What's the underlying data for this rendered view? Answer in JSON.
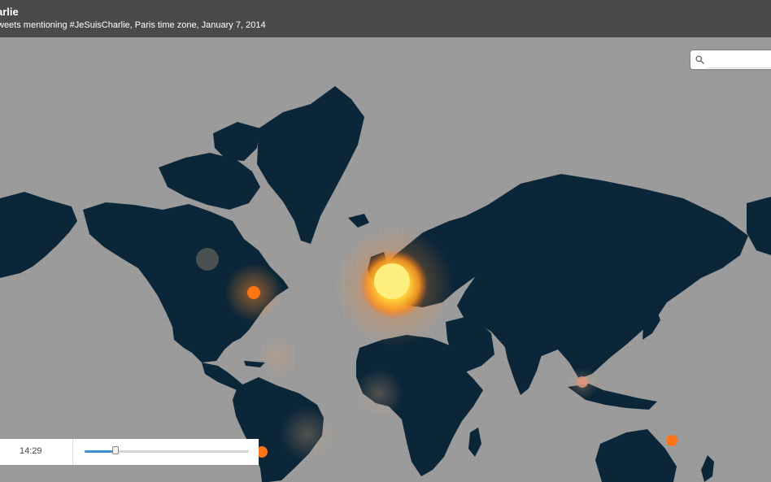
{
  "header": {
    "title": "arlie",
    "subtitle": "weets mentioning #JeSuisCharlie, Paris time zone, January 7, 2014"
  },
  "search": {
    "placeholder": ""
  },
  "timeline": {
    "time": "14:29",
    "progress": 0.19
  },
  "colors": {
    "ocean": "#9a9a9a",
    "land": "#0b2638",
    "header": "#4a4a4a",
    "hotspot_core": "#ffe96a",
    "hotspot_glow": "#ff7a1a",
    "point": "#ff7417",
    "slider_fill": "#3d8fd1"
  },
  "icons": {
    "search": "search-icon"
  }
}
